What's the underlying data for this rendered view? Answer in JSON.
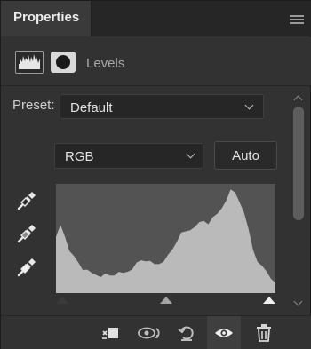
{
  "header": {
    "tab_label": "Properties"
  },
  "adjustment": {
    "name": "Levels"
  },
  "preset": {
    "label": "Preset:",
    "value": "Default"
  },
  "channel": {
    "value": "RGB"
  },
  "auto_button": {
    "label": "Auto"
  },
  "histogram": {
    "shape": [
      0.5,
      0.62,
      0.52,
      0.4,
      0.33,
      0.28,
      0.22,
      0.2,
      0.18,
      0.17,
      0.16,
      0.17,
      0.16,
      0.17,
      0.18,
      0.18,
      0.2,
      0.23,
      0.27,
      0.3,
      0.3,
      0.28,
      0.26,
      0.27,
      0.3,
      0.34,
      0.4,
      0.48,
      0.54,
      0.56,
      0.58,
      0.62,
      0.64,
      0.66,
      0.64,
      0.68,
      0.72,
      0.78,
      0.86,
      0.94,
      0.92,
      0.84,
      0.72,
      0.58,
      0.4,
      0.3,
      0.24,
      0.2,
      0.14,
      0.08
    ],
    "slider_black": 0.0,
    "slider_gamma": 0.5,
    "slider_white": 1.0
  },
  "colors": {
    "panel_bg": "#323232",
    "header_bg": "#262626",
    "histogram_bg": "#535353",
    "histogram_fill": "#bababa"
  }
}
